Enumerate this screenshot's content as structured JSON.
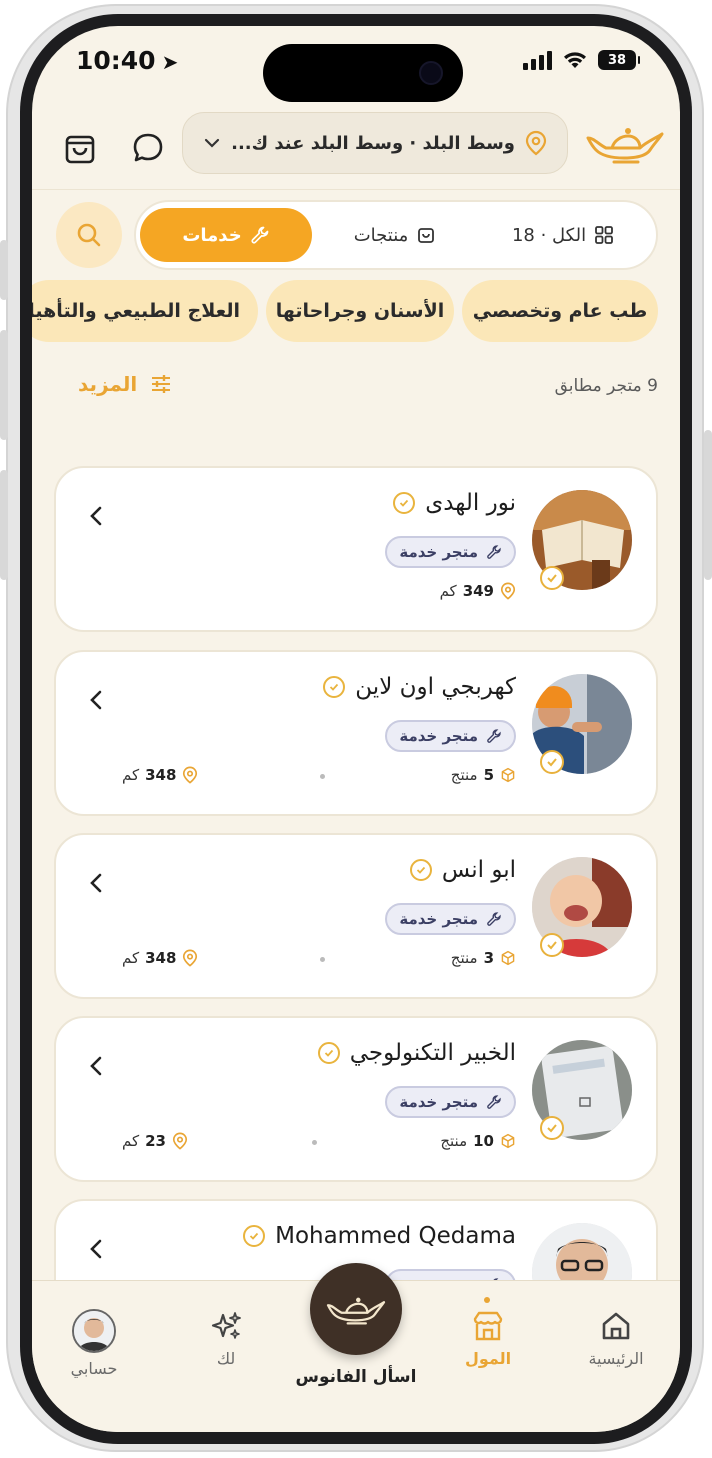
{
  "status_bar": {
    "time": "10:40",
    "battery": "38"
  },
  "header": {
    "location_text": "وسط البلد · وسط البلد عند ك..."
  },
  "tabs": [
    {
      "label": "الكل · 18",
      "icon": "grid-icon",
      "active": false
    },
    {
      "label": "منتجات",
      "icon": "bag-icon",
      "active": false
    },
    {
      "label": "خدمات",
      "icon": "wrench-icon",
      "active": true
    }
  ],
  "categories": [
    {
      "label": "طب عام وتخصصي"
    },
    {
      "label": "الأسنان وجراحاتها"
    },
    {
      "label": "العلاج الطبيعي والتأهيل"
    }
  ],
  "results": {
    "count_text": "9 متجر مطابق",
    "more_label": "المزيد"
  },
  "stores": [
    {
      "name": "نور الهدى",
      "tag": "متجر خدمة",
      "products": "",
      "products_unit": "",
      "distance": "349",
      "distance_unit": "كم"
    },
    {
      "name": "كهربجي اون لاين",
      "tag": "متجر خدمة",
      "products": "5",
      "products_unit": "منتج",
      "distance": "348",
      "distance_unit": "كم"
    },
    {
      "name": "ابو انس",
      "tag": "متجر خدمة",
      "products": "3",
      "products_unit": "منتج",
      "distance": "348",
      "distance_unit": "كم"
    },
    {
      "name": "الخبير التكنولوجي",
      "tag": "متجر خدمة",
      "products": "10",
      "products_unit": "منتج",
      "distance": "23",
      "distance_unit": "كم"
    },
    {
      "name": "Mohammed Qedama",
      "tag": "متجر خدمة",
      "products": "",
      "products_unit": "",
      "distance": "",
      "distance_unit": ""
    }
  ],
  "bottom_nav": {
    "home": "الرئيسية",
    "mall": "المول",
    "ask": "اسأل الفانوس",
    "for_you": "لك",
    "account": "حسابي"
  },
  "colors": {
    "accent": "#f5a623",
    "background": "#f8f3e8",
    "chip": "#fbe7b8"
  }
}
